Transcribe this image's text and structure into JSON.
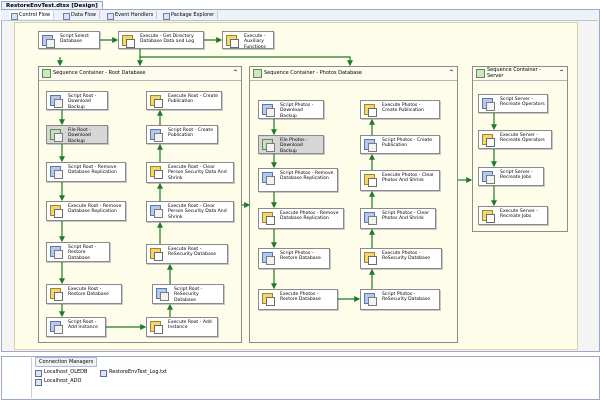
{
  "document": {
    "tab_title": "RestoreEnvTest.dtsx [Design]"
  },
  "designer_tabs": [
    {
      "label": "Control Flow",
      "icon": "control-flow-icon",
      "active": true
    },
    {
      "label": "Data Flow",
      "icon": "data-flow-icon",
      "active": false
    },
    {
      "label": "Event Handlers",
      "icon": "event-handlers-icon",
      "active": false
    },
    {
      "label": "Package Explorer",
      "icon": "package-explorer-icon",
      "active": false
    }
  ],
  "top_tasks": [
    {
      "label": "Script Select Database",
      "kind": "script"
    },
    {
      "label": "Execute - Get Directory Database Data and Log",
      "kind": "exec"
    },
    {
      "label": "Execute - Auxiliary Functions",
      "kind": "exec"
    }
  ],
  "containers": [
    {
      "title": "Sequence Container - Root Database",
      "tasks": [
        {
          "label": "Script Root - Download Backup",
          "kind": "script"
        },
        {
          "label": "File Root - Download Backup",
          "kind": "file",
          "disabled": true
        },
        {
          "label": "Script Root - Remove Database Replication",
          "kind": "script"
        },
        {
          "label": "Execute Root - Remove Database Replication",
          "kind": "exec"
        },
        {
          "label": "Script Root - Restore Database",
          "kind": "script"
        },
        {
          "label": "Execute Root - Restore Database",
          "kind": "exec"
        },
        {
          "label": "Script Root - Add Instance",
          "kind": "script"
        },
        {
          "label": "Execute Root - Add Instance",
          "kind": "exec"
        },
        {
          "label": "Script Root - ReSecurity Database",
          "kind": "script"
        },
        {
          "label": "Execute Root - ReSecurity Database",
          "kind": "exec"
        },
        {
          "label": "Execute Root - Clear Person Security Data And Shrink",
          "kind": "exec"
        },
        {
          "label": "Execute Root - Clear Person Security Data And Shrink",
          "kind": "exec"
        },
        {
          "label": "Script Root - Create Publication",
          "kind": "script"
        },
        {
          "label": "Execute Root - Create Publication",
          "kind": "exec"
        }
      ]
    },
    {
      "title": "Sequence Container - Photos Database",
      "tasks": [
        {
          "label": "Script Photos - Download Backup",
          "kind": "script"
        },
        {
          "label": "File Photos - Download Backup",
          "kind": "file",
          "disabled": true
        },
        {
          "label": "Script Photos - Remove Database Replication",
          "kind": "script"
        },
        {
          "label": "Execute Photos - Remove Database Replication",
          "kind": "exec"
        },
        {
          "label": "Script Photos - Restore Database",
          "kind": "script"
        },
        {
          "label": "Execute Photos - Restore Database",
          "kind": "exec"
        },
        {
          "label": "Script Photos - ReSecurity Database",
          "kind": "script"
        },
        {
          "label": "Execute Photos - ReSecurity Database",
          "kind": "exec"
        },
        {
          "label": "Script Photos - Clear Photos And Shrink",
          "kind": "script"
        },
        {
          "label": "Execute Photos - Clear Photos And Shrink",
          "kind": "exec"
        },
        {
          "label": "Script Photos - Create Publication",
          "kind": "script"
        },
        {
          "label": "Execute Photos - Create Publication",
          "kind": "exec"
        }
      ]
    },
    {
      "title": "Sequence Container - Server",
      "tasks": [
        {
          "label": "Script Server - Recreate Operators",
          "kind": "script"
        },
        {
          "label": "Execute Server - Recreate Operators",
          "kind": "exec"
        },
        {
          "label": "Script Server - Recreate Jobs",
          "kind": "script"
        },
        {
          "label": "Execute Server - Recreate Jobs",
          "kind": "exec"
        }
      ]
    }
  ],
  "connection_managers": {
    "tab_label": "Connection Managers",
    "items": [
      "Localhost_OLEDB",
      "RestoreEnvTest_Log.txt",
      "Localhost_ADO"
    ]
  },
  "colors": {
    "canvas": "#fefde9",
    "success_arrow": "#1f7a2b",
    "disabled_task": "#d6d6d6"
  }
}
